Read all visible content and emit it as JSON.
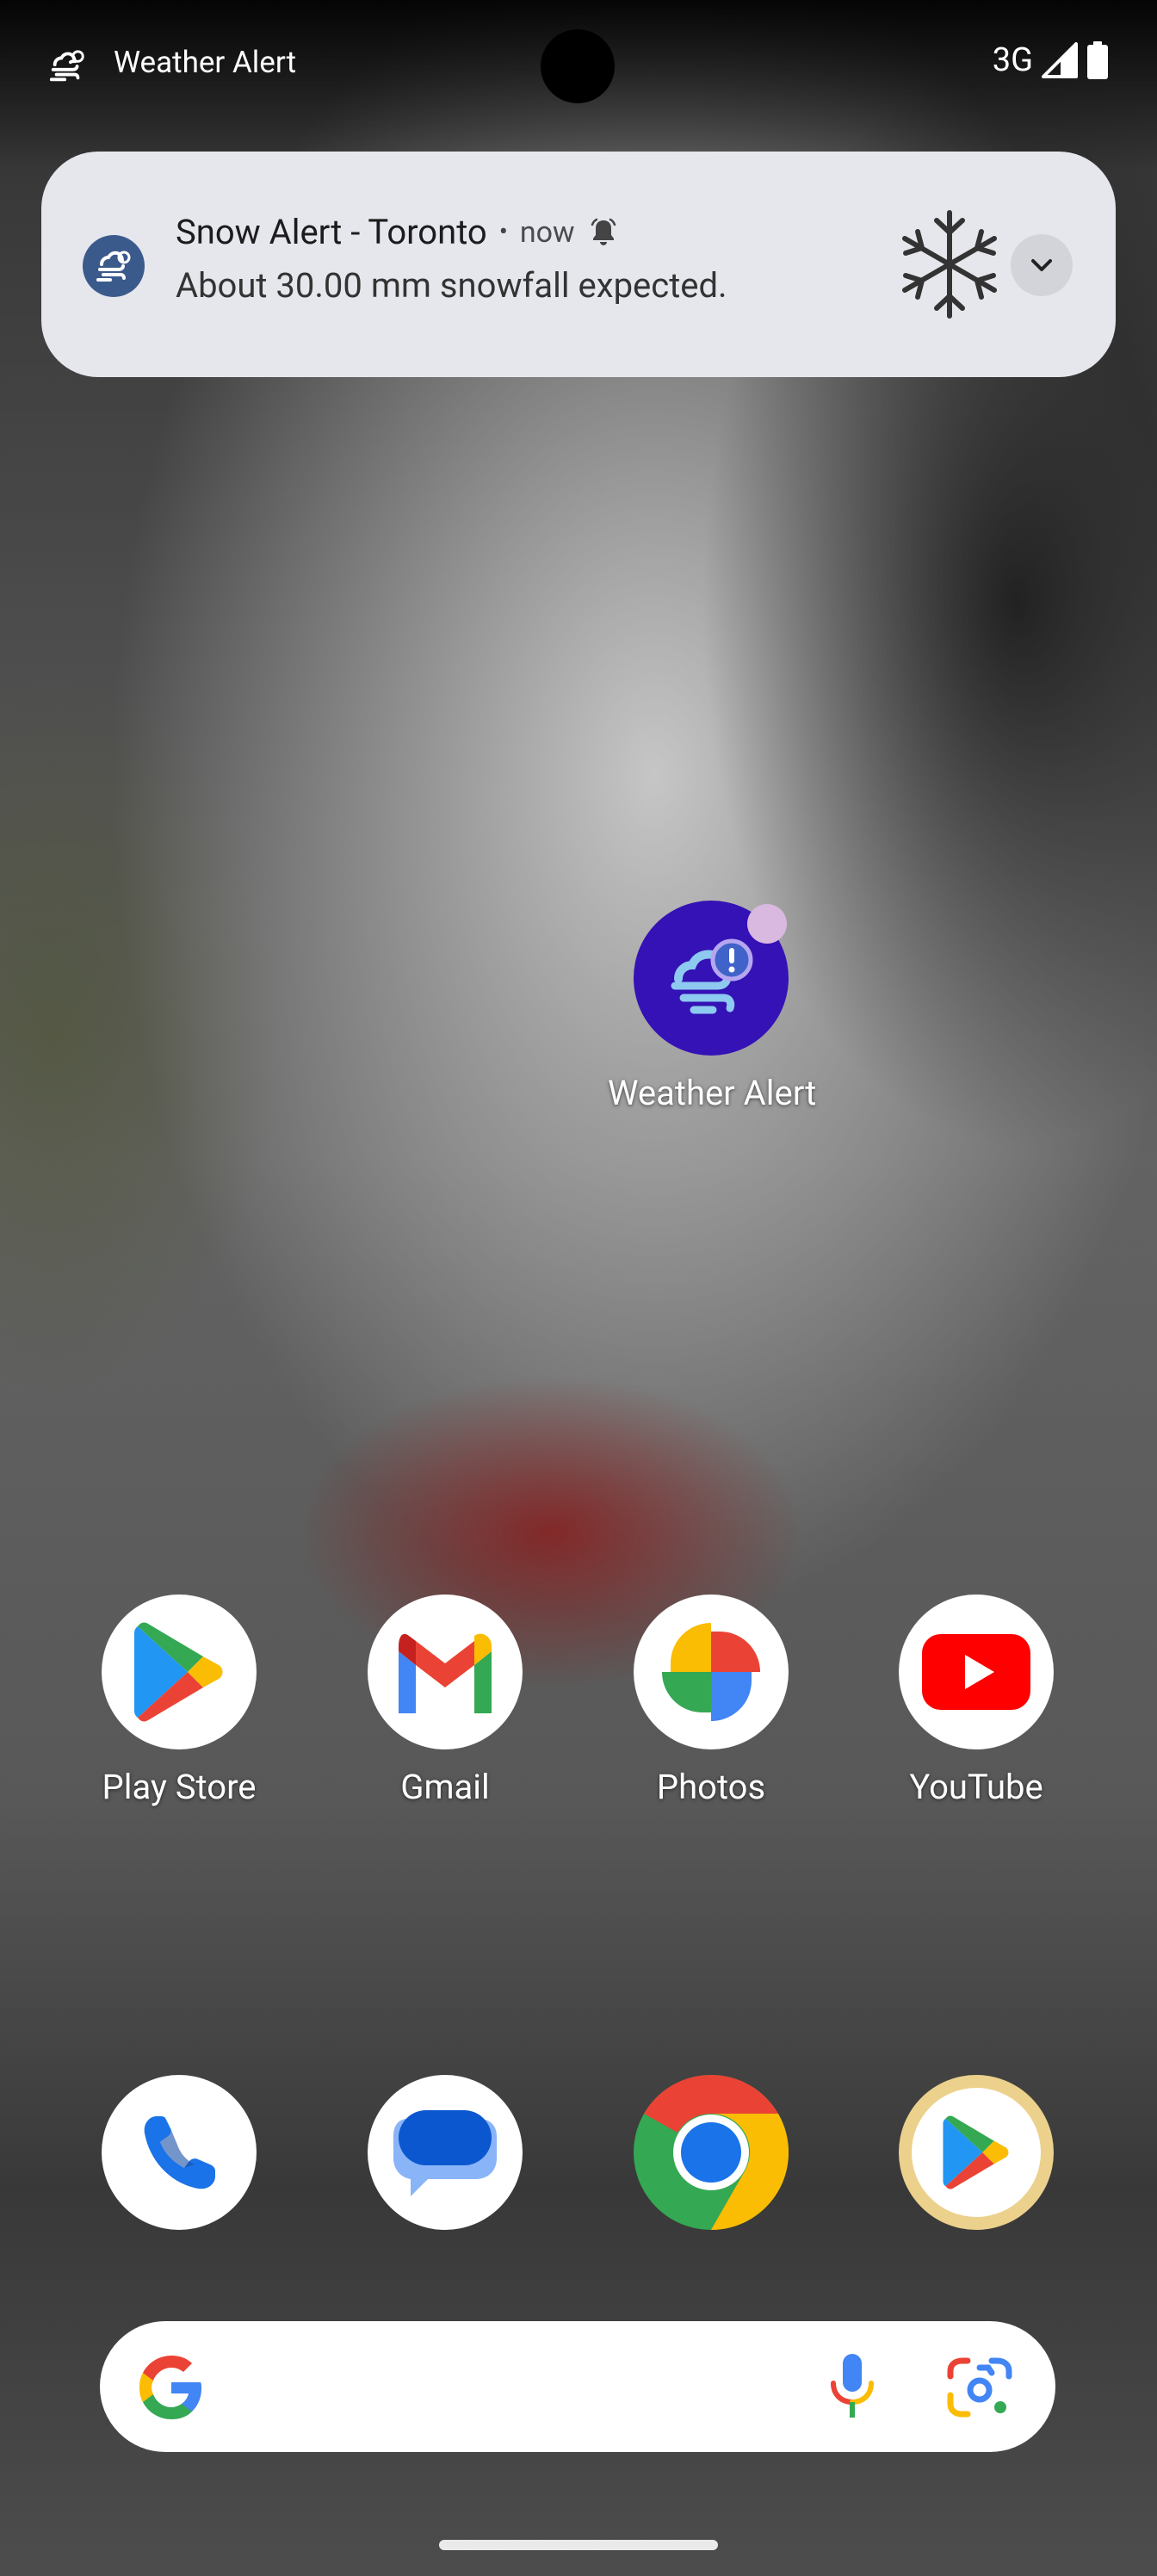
{
  "status_bar": {
    "app_title": "Weather Alert",
    "network": "3G"
  },
  "notification": {
    "title": "Snow Alert - Toronto",
    "separator": "•",
    "time": "now",
    "body": "About 30.00 mm snowfall expected.",
    "icon": "snowflake-icon"
  },
  "home": {
    "weather_app": {
      "label": "Weather Alert"
    },
    "apps_row": [
      {
        "label": "Play Store"
      },
      {
        "label": "Gmail"
      },
      {
        "label": "Photos"
      },
      {
        "label": "YouTube"
      }
    ],
    "dock": [
      {
        "name": "phone"
      },
      {
        "name": "messages"
      },
      {
        "name": "chrome"
      },
      {
        "name": "play-games"
      }
    ]
  },
  "colors": {
    "notification_bg": "#e6e7ec",
    "weather_app_bg": "#3412b5",
    "badge": "#d9b9e0"
  }
}
